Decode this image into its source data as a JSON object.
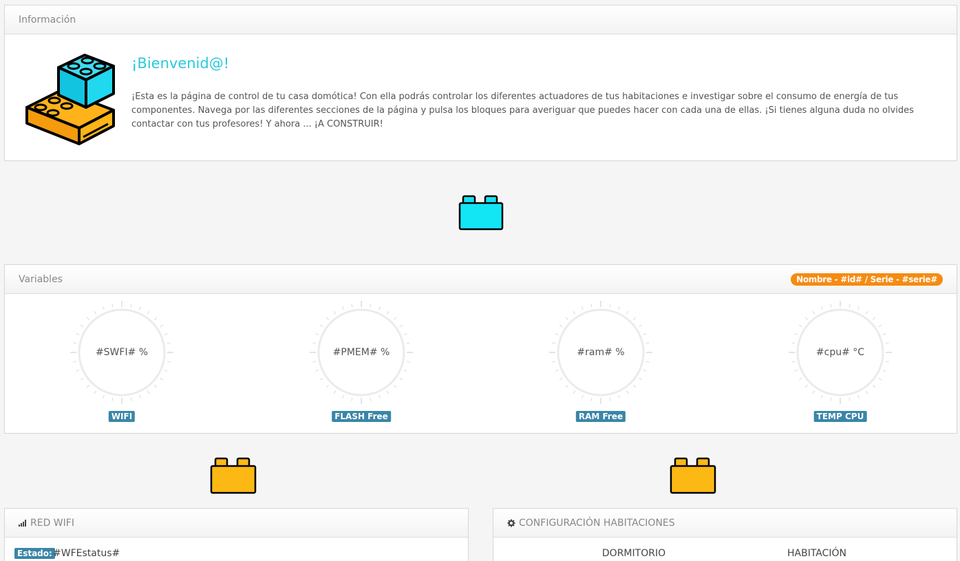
{
  "info": {
    "header": "Información",
    "title": "¡Bienvenid@!",
    "text": "¡Esta es la página de control de tu casa domótica! Con ella podrás controlar los diferentes actuadores de tus habitaciones e investigar sobre el consumo de energía de tus componentes. Navega por las diferentes secciones de la página y pulsa los bloques para averiguar que puedes hacer con cada una de ellas. ¡Si tienes alguna duda no olvides contactar con tus profesores! Y ahora ... ¡A CONSTRUIR!"
  },
  "variables": {
    "header": "Variables",
    "badge": "Nombre - #id# / Serie - #serie#",
    "gauges": [
      {
        "value": "#SWFI# %",
        "label": "WIFI"
      },
      {
        "value": "#PMEM# %",
        "label": "FLASH Free"
      },
      {
        "value": "#ram# %",
        "label": "RAM Free"
      },
      {
        "value": "#cpu# °C",
        "label": "TEMP CPU"
      }
    ]
  },
  "wifi": {
    "header": "RED WIFI",
    "estado_label": "Estado:",
    "estado_value": "#WFEstatus#"
  },
  "config": {
    "header": "CONFIGURACIÓN HABITACIONES",
    "columns": [
      "DORMITORIO",
      "HABITACIÓN"
    ]
  },
  "colors": {
    "accent_cyan": "#2bc8de",
    "brick_cyan": "#12e6f5",
    "brick_orange": "#fcb913",
    "badge_blue": "#3a86a8",
    "badge_orange": "#f58b12"
  },
  "icons": {
    "signal": "signal-icon",
    "gear": "gear-icon"
  }
}
